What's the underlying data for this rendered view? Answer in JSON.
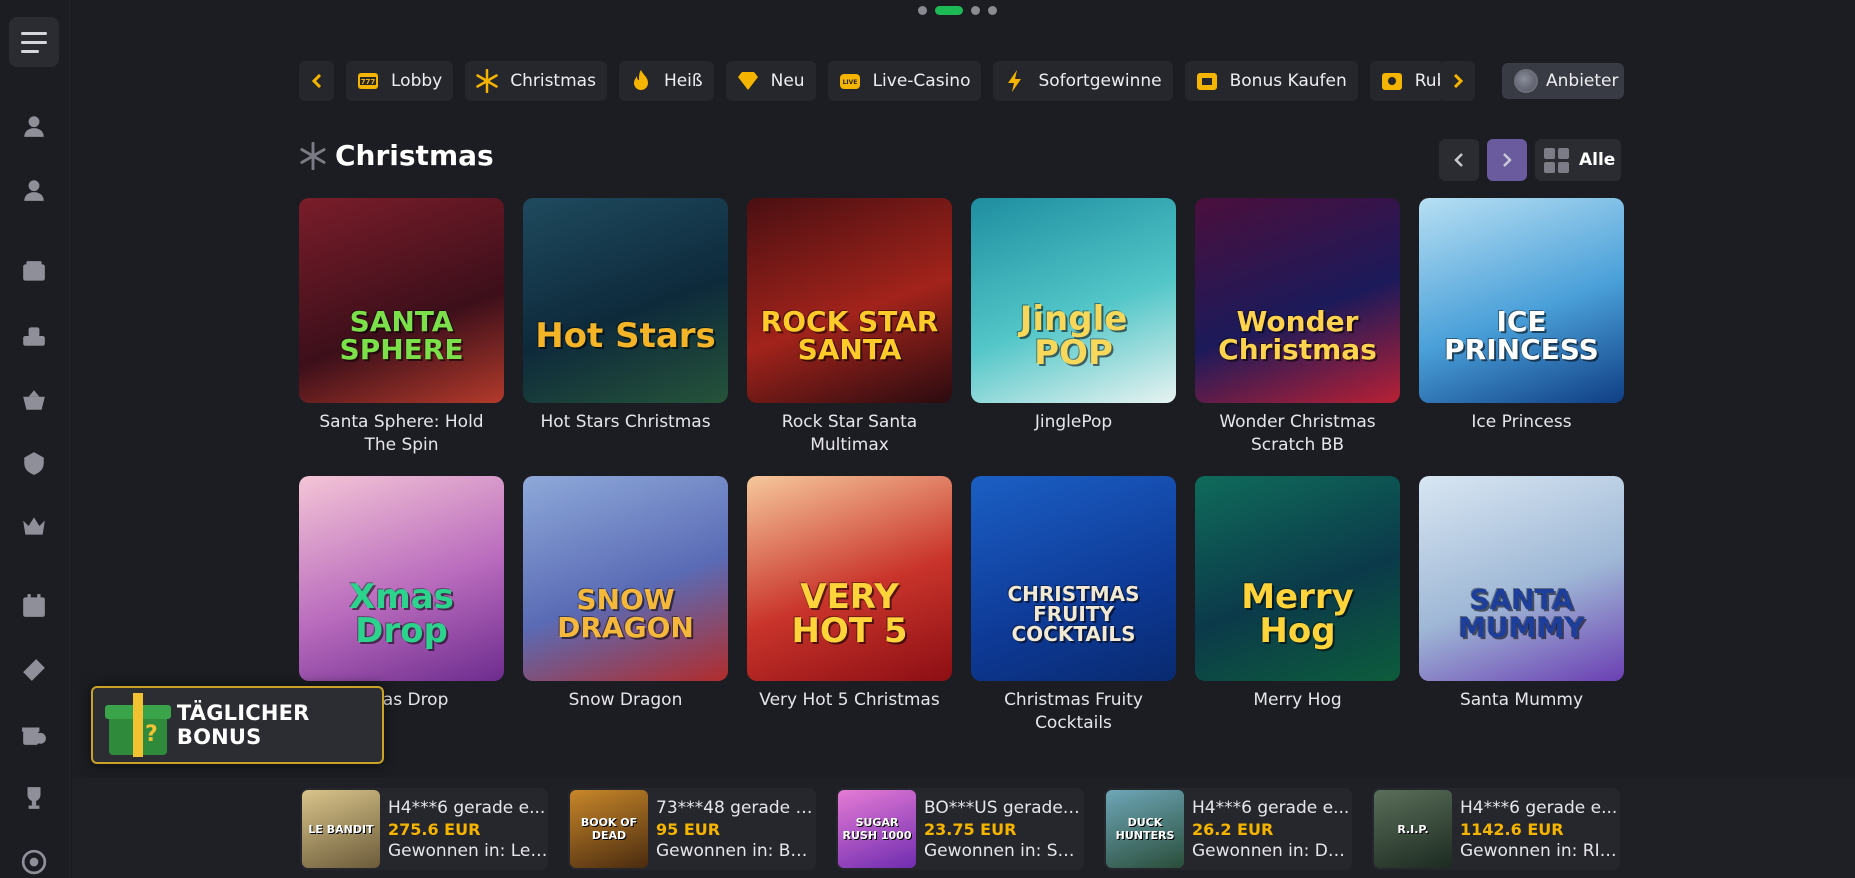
{
  "pagination": {
    "count": 4,
    "active_index": 1
  },
  "categories": [
    {
      "label": "Lobby",
      "icon": "slot-777-icon",
      "color": "#f5b400"
    },
    {
      "label": "Christmas",
      "icon": "snowflake-icon",
      "color": "#f5b400"
    },
    {
      "label": "Heiß",
      "icon": "flame-icon",
      "color": "#f5b400"
    },
    {
      "label": "Neu",
      "icon": "diamond-icon",
      "color": "#f5b400"
    },
    {
      "label": "Live-Casino",
      "icon": "live-tv-icon",
      "color": "#f5b400"
    },
    {
      "label": "Sofortgewinne",
      "icon": "lightning-icon",
      "color": "#f5b400"
    },
    {
      "label": "Bonus Kaufen",
      "icon": "bonus-ticket-icon",
      "color": "#f5b400"
    },
    {
      "label": "Rub",
      "icon": "cinema-icon",
      "color": "#f5b400"
    }
  ],
  "provider_button": {
    "label": "Anbieter",
    "icon": "globe-icon"
  },
  "section": {
    "title": "Christmas",
    "icon": "snowflake-icon",
    "all_label": "Alle"
  },
  "games": [
    {
      "name": "Santa Sphere: Hold The Spin",
      "logo": "SANTA SPHERE",
      "bg": "linear-gradient(160deg,#7a1d2a,#3c0f1a 60%,#b33a2b)",
      "logo_color": "#7be04a"
    },
    {
      "name": "Hot Stars Christmas",
      "logo": "Hot Stars",
      "bg": "linear-gradient(160deg,#1f4a5e,#0d2a3b 55%,#26533a)",
      "logo_color": "#f4b428"
    },
    {
      "name": "Rock Star Santa Multimax",
      "logo": "ROCK STAR SANTA",
      "bg": "linear-gradient(160deg,#4a0f12,#a2231b 55%,#2a0b10)",
      "logo_color": "#ffcb2b"
    },
    {
      "name": "JinglePop",
      "logo": "Jingle POP",
      "bg": "linear-gradient(160deg,#1e8ea0,#52c6c8 55%,#e7f3f1)",
      "logo_color": "#f7d85a"
    },
    {
      "name": "Wonder Christmas Scratch BB",
      "logo": "Wonder Christmas",
      "bg": "linear-gradient(160deg,#4b0f3c,#1c1a5a 55%,#b82034)",
      "logo_color": "#ffd34d"
    },
    {
      "name": "Ice Princess",
      "logo": "ICE PRINCESS",
      "bg": "linear-gradient(160deg,#b7dff3,#4aa0d9 55%,#0f3e84)",
      "logo_color": "#ffffff"
    },
    {
      "name": "Xmas Drop",
      "logo": "Xmas Drop",
      "bg": "linear-gradient(160deg,#f4c5d6,#b96bbd 55%,#6d2c8e)",
      "logo_color": "#2bd38d"
    },
    {
      "name": "Snow Dragon",
      "logo": "SNOW DRAGON",
      "bg": "linear-gradient(160deg,#8ea9d9,#5a6bb5 55%,#b12c2c)",
      "logo_color": "#f5b83a"
    },
    {
      "name": "Very Hot 5 Christmas",
      "logo": "VERY HOT 5",
      "bg": "linear-gradient(160deg,#f6c89b,#c9342b 55%,#8c0e14)",
      "logo_color": "#ffd43b"
    },
    {
      "name": "Christmas Fruity Cocktails",
      "logo": "CHRISTMAS FRUITY COCKTAILS",
      "bg": "linear-gradient(160deg,#1b5fc4,#0e3a97 60%,#082a6f)",
      "logo_color": "#f2e9d4"
    },
    {
      "name": "Merry Hog",
      "logo": "Merry Hog",
      "bg": "linear-gradient(160deg,#0f6b5a,#0b3a4a 55%,#0d5c3c)",
      "logo_color": "#ffd43b"
    },
    {
      "name": "Santa Mummy",
      "logo": "SANTA MUMMY",
      "bg": "linear-gradient(160deg,#d8e6f2,#9fb8d6 55%,#6b3fb3)",
      "logo_color": "#1d3e9a"
    }
  ],
  "bonus_popup": {
    "label": "TÄGLICHER BONUS",
    "icon": "mystery-gift-icon"
  },
  "winners": [
    {
      "user": "H4***6 gerade e...",
      "amount": "275.6 EUR",
      "game": "Gewonnen in: Le ...",
      "thumb": "LE BANDIT",
      "bg": "linear-gradient(160deg,#d9c48a,#6b5b3a)"
    },
    {
      "user": "73***48 gerade e...",
      "amount": "95 EUR",
      "game": "Gewonnen in: Bo...",
      "thumb": "BOOK OF DEAD",
      "bg": "linear-gradient(160deg,#c8872a,#4a2b0f)"
    },
    {
      "user": "BO***US gerade ...",
      "amount": "23.75 EUR",
      "game": "Gewonnen in: Su...",
      "thumb": "SUGAR RUSH 1000",
      "bg": "linear-gradient(160deg,#e57bd5,#6f2cb0)"
    },
    {
      "user": "H4***6 gerade e...",
      "amount": "26.2 EUR",
      "game": "Gewonnen in: Du...",
      "thumb": "DUCK HUNTERS",
      "bg": "linear-gradient(160deg,#6ea7b8,#2a4d3a)"
    },
    {
      "user": "H4***6 gerade e...",
      "amount": "1142.6 EUR",
      "game": "Gewonnen in: RIP ...",
      "thumb": "R.I.P.",
      "bg": "linear-gradient(160deg,#5a6f5a,#1c2a20)"
    }
  ],
  "sidebar_icons": [
    "user-outline-icon",
    "user-icon",
    "slot-machine-icon",
    "casino-chip-icon",
    "basket-icon",
    "crest-icon",
    "crown-icon",
    "calendar-icon",
    "ticket-icon",
    "gift-clock-icon",
    "trophy-icon",
    "target-icon"
  ]
}
